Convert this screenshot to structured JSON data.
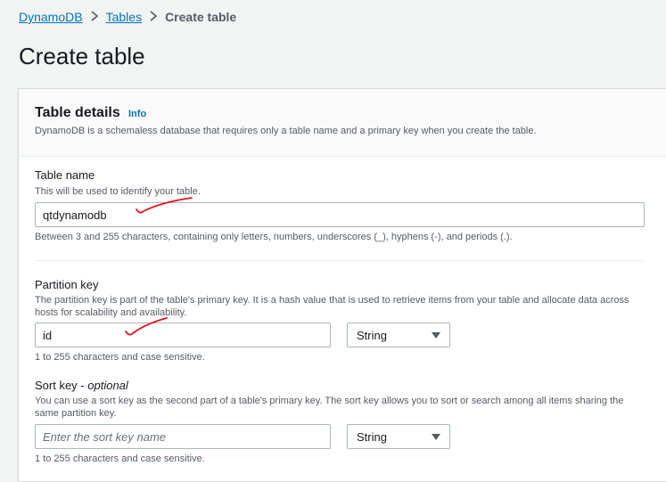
{
  "breadcrumb": {
    "items": [
      "DynamoDB",
      "Tables"
    ],
    "current": "Create table"
  },
  "page_title": "Create table",
  "panel": {
    "title": "Table details",
    "info_label": "Info",
    "description": "DynamoDB is a schemaless database that requires only a table name and a primary key when you create the table."
  },
  "table_name": {
    "label": "Table name",
    "description": "This will be used to identify your table.",
    "value": "qtdynamodb",
    "constraint": "Between 3 and 255 characters, containing only letters, numbers, underscores (_), hyphens (-), and periods (.)."
  },
  "partition_key": {
    "label": "Partition key",
    "description": "The partition key is part of the table's primary key. It is a hash value that is used to retrieve items from your table and allocate data across hosts for scalability and availability.",
    "value": "id",
    "type": "String",
    "constraint": "1 to 255 characters and case sensitive."
  },
  "sort_key": {
    "label": "Sort key",
    "optional": "optional",
    "description": "You can use a sort key as the second part of a table's primary key. The sort key allows you to sort or search among all items sharing the same partition key.",
    "placeholder": "Enter the sort key name",
    "value": "",
    "type": "String",
    "constraint": "1 to 255 characters and case sensitive."
  },
  "colors": {
    "link": "#0073bb",
    "annotation": "#e0141e"
  },
  "icons": {
    "separator": "chevron-right-icon",
    "dropdown": "caret-down-icon"
  }
}
